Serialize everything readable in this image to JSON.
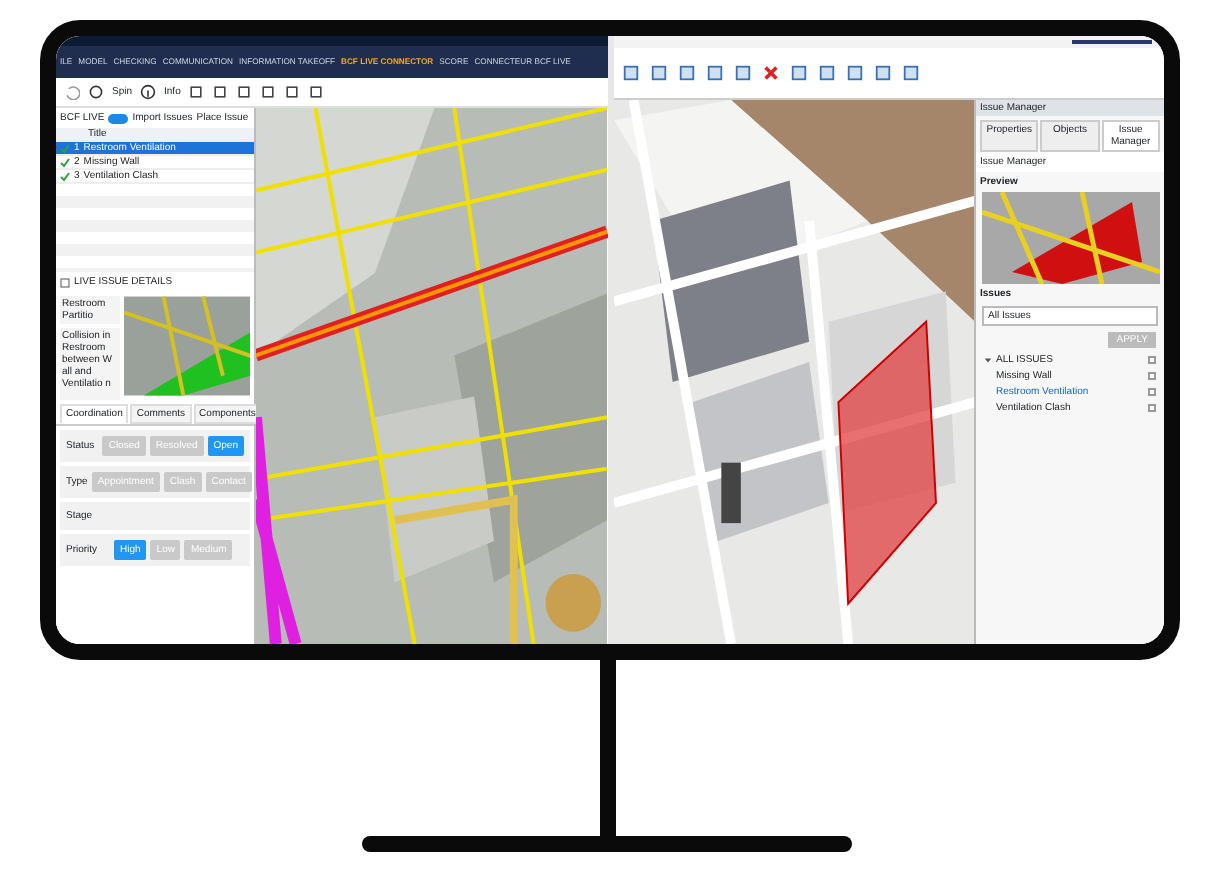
{
  "left_app": {
    "menu_tabs": [
      {
        "label": "ILE",
        "selected": false
      },
      {
        "label": "MODEL",
        "selected": false
      },
      {
        "label": "CHECKING",
        "selected": false
      },
      {
        "label": "COMMUNICATION",
        "selected": false
      },
      {
        "label": "INFORMATION TAKEOFF",
        "selected": false
      },
      {
        "label": "BCF LIVE CONNECTOR",
        "selected": true
      },
      {
        "label": "SCORE",
        "selected": false
      },
      {
        "label": "CONNECTEUR BCF LIVE",
        "selected": false
      }
    ],
    "toolbar": {
      "spin_label": "Spin",
      "info_label": "Info"
    },
    "bcf_panel": {
      "title": "BCF LIVE",
      "toggle_on": true,
      "import_label": "Import Issues",
      "place_label": "Place Issue",
      "column": "Title",
      "issues": [
        {
          "number": "1",
          "title": "Restroom Ventilation",
          "selected": true
        },
        {
          "number": "2",
          "title": "Missing Wall",
          "selected": false
        },
        {
          "number": "3",
          "title": "Ventilation Clash",
          "selected": false
        }
      ]
    },
    "details": {
      "heading": "LIVE ISSUE DETAILS",
      "title": "Restroom Partitio",
      "description": "Collision in Restroom between W all and Ventilatio n",
      "tabs": [
        {
          "label": "Coordination",
          "selected": true
        },
        {
          "label": "Comments",
          "selected": false
        },
        {
          "label": "Components",
          "selected": false
        }
      ],
      "fields": [
        {
          "label": "Status",
          "options": [
            {
              "label": "Closed",
              "selected": false
            },
            {
              "label": "Resolved",
              "selected": false
            },
            {
              "label": "Open",
              "selected": true
            }
          ]
        },
        {
          "label": "Type",
          "options": [
            {
              "label": "Appointment",
              "selected": false
            },
            {
              "label": "Clash",
              "selected": false
            },
            {
              "label": "Contact",
              "selected": false
            }
          ]
        },
        {
          "label": "Stage"
        },
        {
          "label": "Priority",
          "options": [
            {
              "label": "High",
              "selected": true
            },
            {
              "label": "Low",
              "selected": false
            },
            {
              "label": "Medium",
              "selected": false
            }
          ]
        }
      ]
    }
  },
  "right_app": {
    "panel": {
      "title": "Issue Manager",
      "tabs": [
        {
          "label": "Properties",
          "selected": false
        },
        {
          "label": "Objects",
          "selected": false
        },
        {
          "label": "Issue Manager",
          "selected": true
        }
      ],
      "subtitle": "Issue Manager",
      "preview_heading": "Preview",
      "issues_heading": "Issues",
      "filter": "All Issues",
      "apply_label": "APPLY",
      "tree": [
        {
          "label": "ALL ISSUES",
          "expanded": true,
          "checked": false,
          "children": [
            {
              "label": "Missing Wall",
              "selected": false,
              "checked": false
            },
            {
              "label": "Restroom Ventilation",
              "selected": true,
              "checked": false
            },
            {
              "label": "Ventilation Clash",
              "selected": false,
              "checked": false
            }
          ]
        }
      ]
    }
  }
}
